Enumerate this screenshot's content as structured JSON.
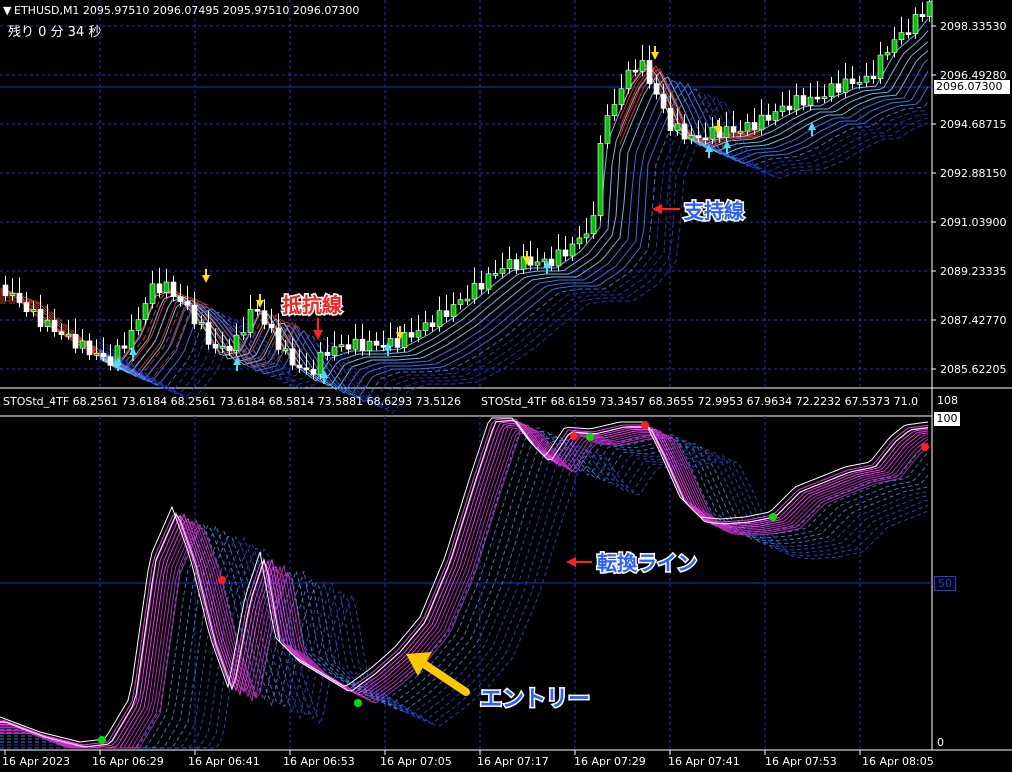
{
  "main_chart": {
    "header": "ETHUSD,M1  2095.97510 2096.07495 2095.97510 2096.07300",
    "remaining_time": "残り 0 分 34 秒",
    "price_labels": [
      "2098.33530",
      "2096.49280",
      "2094.68715",
      "2092.88150",
      "2091.03900",
      "2089.23335",
      "2087.42770",
      "2085.62205"
    ],
    "current_price": "2096.07300",
    "annotations": {
      "resistance": "抵抗線",
      "support": "支持線"
    }
  },
  "sub_chart": {
    "header_1": "STOStd_4TF 68.2561 73.6184 68.2561 73.6184 68.5814 73.5881 68.6293 73.5126",
    "header_2": "STOStd_4TF 68.6159 73.3457 68.3655 72.9953 67.9634 72.2232 67.5373 71.0",
    "level_top": "108",
    "level_100": "100",
    "level_50": "50",
    "level_0": "0",
    "annotations": {
      "switch_line": "転換ライン",
      "entry": "エントリー"
    }
  },
  "time_axis": [
    "16 Apr 2023",
    "16 Apr 06:29",
    "16 Apr 06:41",
    "16 Apr 06:53",
    "16 Apr 07:05",
    "16 Apr 07:17",
    "16 Apr 07:29",
    "16 Apr 07:41",
    "16 Apr 07:53",
    "16 Apr 08:05"
  ],
  "colors": {
    "background": "#000000",
    "grid": "#1a3fff",
    "bull_candle": "#00c800",
    "bear_candle": "#ffffff",
    "annotation_red": "#ff2020",
    "annotation_blue": "#2a60ff",
    "entry_arrow": "#ffc800",
    "stoch_main": "#ff40ff",
    "stoch_long": "#3080ff"
  }
}
